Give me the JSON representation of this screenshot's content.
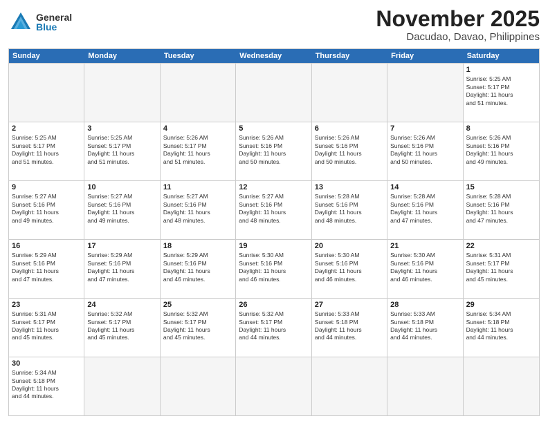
{
  "logo": {
    "general": "General",
    "blue": "Blue"
  },
  "title": "November 2025",
  "location": "Dacudao, Davao, Philippines",
  "weekdays": [
    "Sunday",
    "Monday",
    "Tuesday",
    "Wednesday",
    "Thursday",
    "Friday",
    "Saturday"
  ],
  "rows": [
    [
      {
        "day": "",
        "info": ""
      },
      {
        "day": "",
        "info": ""
      },
      {
        "day": "",
        "info": ""
      },
      {
        "day": "",
        "info": ""
      },
      {
        "day": "",
        "info": ""
      },
      {
        "day": "",
        "info": ""
      },
      {
        "day": "1",
        "info": "Sunrise: 5:25 AM\nSunset: 5:17 PM\nDaylight: 11 hours\nand 51 minutes."
      }
    ],
    [
      {
        "day": "2",
        "info": "Sunrise: 5:25 AM\nSunset: 5:17 PM\nDaylight: 11 hours\nand 51 minutes."
      },
      {
        "day": "3",
        "info": "Sunrise: 5:25 AM\nSunset: 5:17 PM\nDaylight: 11 hours\nand 51 minutes."
      },
      {
        "day": "4",
        "info": "Sunrise: 5:26 AM\nSunset: 5:17 PM\nDaylight: 11 hours\nand 51 minutes."
      },
      {
        "day": "5",
        "info": "Sunrise: 5:26 AM\nSunset: 5:16 PM\nDaylight: 11 hours\nand 50 minutes."
      },
      {
        "day": "6",
        "info": "Sunrise: 5:26 AM\nSunset: 5:16 PM\nDaylight: 11 hours\nand 50 minutes."
      },
      {
        "day": "7",
        "info": "Sunrise: 5:26 AM\nSunset: 5:16 PM\nDaylight: 11 hours\nand 50 minutes."
      },
      {
        "day": "8",
        "info": "Sunrise: 5:26 AM\nSunset: 5:16 PM\nDaylight: 11 hours\nand 49 minutes."
      }
    ],
    [
      {
        "day": "9",
        "info": "Sunrise: 5:27 AM\nSunset: 5:16 PM\nDaylight: 11 hours\nand 49 minutes."
      },
      {
        "day": "10",
        "info": "Sunrise: 5:27 AM\nSunset: 5:16 PM\nDaylight: 11 hours\nand 49 minutes."
      },
      {
        "day": "11",
        "info": "Sunrise: 5:27 AM\nSunset: 5:16 PM\nDaylight: 11 hours\nand 48 minutes."
      },
      {
        "day": "12",
        "info": "Sunrise: 5:27 AM\nSunset: 5:16 PM\nDaylight: 11 hours\nand 48 minutes."
      },
      {
        "day": "13",
        "info": "Sunrise: 5:28 AM\nSunset: 5:16 PM\nDaylight: 11 hours\nand 48 minutes."
      },
      {
        "day": "14",
        "info": "Sunrise: 5:28 AM\nSunset: 5:16 PM\nDaylight: 11 hours\nand 47 minutes."
      },
      {
        "day": "15",
        "info": "Sunrise: 5:28 AM\nSunset: 5:16 PM\nDaylight: 11 hours\nand 47 minutes."
      }
    ],
    [
      {
        "day": "16",
        "info": "Sunrise: 5:29 AM\nSunset: 5:16 PM\nDaylight: 11 hours\nand 47 minutes."
      },
      {
        "day": "17",
        "info": "Sunrise: 5:29 AM\nSunset: 5:16 PM\nDaylight: 11 hours\nand 47 minutes."
      },
      {
        "day": "18",
        "info": "Sunrise: 5:29 AM\nSunset: 5:16 PM\nDaylight: 11 hours\nand 46 minutes."
      },
      {
        "day": "19",
        "info": "Sunrise: 5:30 AM\nSunset: 5:16 PM\nDaylight: 11 hours\nand 46 minutes."
      },
      {
        "day": "20",
        "info": "Sunrise: 5:30 AM\nSunset: 5:16 PM\nDaylight: 11 hours\nand 46 minutes."
      },
      {
        "day": "21",
        "info": "Sunrise: 5:30 AM\nSunset: 5:16 PM\nDaylight: 11 hours\nand 46 minutes."
      },
      {
        "day": "22",
        "info": "Sunrise: 5:31 AM\nSunset: 5:17 PM\nDaylight: 11 hours\nand 45 minutes."
      }
    ],
    [
      {
        "day": "23",
        "info": "Sunrise: 5:31 AM\nSunset: 5:17 PM\nDaylight: 11 hours\nand 45 minutes."
      },
      {
        "day": "24",
        "info": "Sunrise: 5:32 AM\nSunset: 5:17 PM\nDaylight: 11 hours\nand 45 minutes."
      },
      {
        "day": "25",
        "info": "Sunrise: 5:32 AM\nSunset: 5:17 PM\nDaylight: 11 hours\nand 45 minutes."
      },
      {
        "day": "26",
        "info": "Sunrise: 5:32 AM\nSunset: 5:17 PM\nDaylight: 11 hours\nand 44 minutes."
      },
      {
        "day": "27",
        "info": "Sunrise: 5:33 AM\nSunset: 5:18 PM\nDaylight: 11 hours\nand 44 minutes."
      },
      {
        "day": "28",
        "info": "Sunrise: 5:33 AM\nSunset: 5:18 PM\nDaylight: 11 hours\nand 44 minutes."
      },
      {
        "day": "29",
        "info": "Sunrise: 5:34 AM\nSunset: 5:18 PM\nDaylight: 11 hours\nand 44 minutes."
      }
    ],
    [
      {
        "day": "30",
        "info": "Sunrise: 5:34 AM\nSunset: 5:18 PM\nDaylight: 11 hours\nand 44 minutes."
      },
      {
        "day": "",
        "info": ""
      },
      {
        "day": "",
        "info": ""
      },
      {
        "day": "",
        "info": ""
      },
      {
        "day": "",
        "info": ""
      },
      {
        "day": "",
        "info": ""
      },
      {
        "day": "",
        "info": ""
      }
    ]
  ]
}
